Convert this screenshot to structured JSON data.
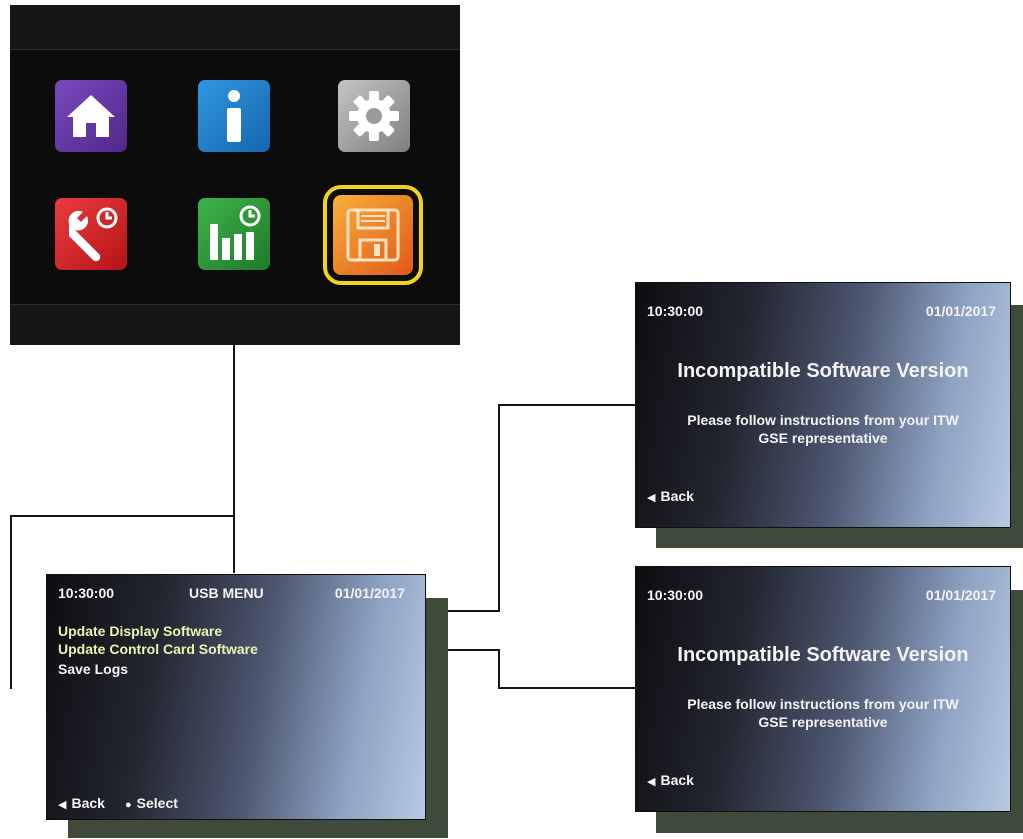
{
  "main_menu": {
    "icons": [
      {
        "name": "home-icon",
        "color": "#6a3aa8"
      },
      {
        "name": "info-icon",
        "color": "#1f7fcf"
      },
      {
        "name": "gear-icon",
        "color": "#9a9a9a"
      },
      {
        "name": "wrench-clock-icon",
        "color": "#d6262a"
      },
      {
        "name": "chart-clock-icon",
        "color": "#2f9a3a"
      },
      {
        "name": "floppy-disk-icon",
        "color": "#f07a20",
        "selected": true
      }
    ],
    "accent_color": "#f2d21b"
  },
  "usb_menu": {
    "time": "10:30:00",
    "title": "USB MENU",
    "date": "01/01/2017",
    "items": [
      "Update Display Software",
      "Update Control Card Software",
      "Save Logs"
    ],
    "footer_back": "Back",
    "footer_select": "Select"
  },
  "popups": [
    {
      "time": "10:30:00",
      "date": "01/01/2017",
      "title": "Incompatible Software Version",
      "message_line1": "Please follow instructions from your ITW",
      "message_line2": "GSE representative",
      "back": "Back"
    },
    {
      "time": "10:30:00",
      "date": "01/01/2017",
      "title": "Incompatible Software Version",
      "message_line1": "Please follow instructions from your ITW",
      "message_line2": "GSE representative",
      "back": "Back"
    }
  ]
}
